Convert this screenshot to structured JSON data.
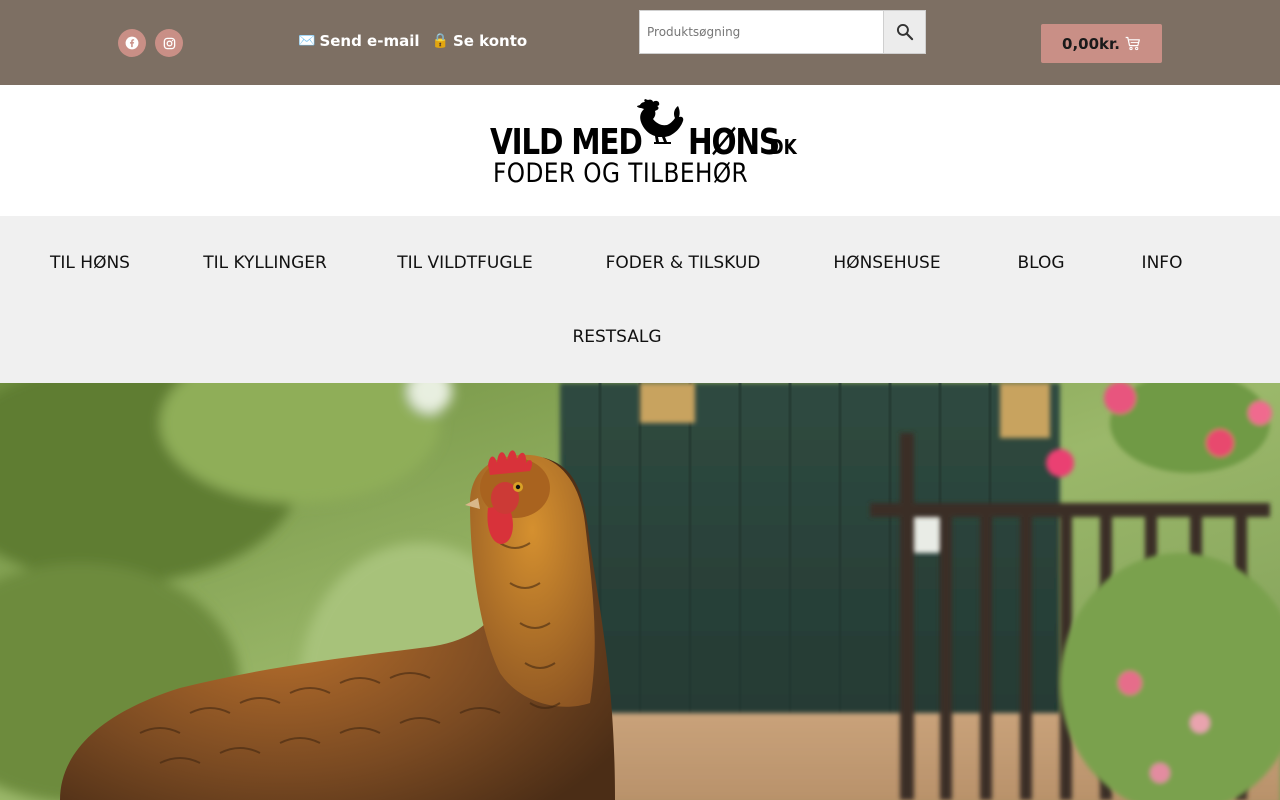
{
  "topbar": {
    "social": [
      {
        "name": "facebook",
        "icon": "facebook-icon"
      },
      {
        "name": "instagram",
        "icon": "instagram-icon"
      }
    ],
    "email_link": {
      "emoji": "✉️",
      "label": "Send e-mail"
    },
    "account_link": {
      "emoji": "🔒",
      "label": "Se konto"
    },
    "search": {
      "placeholder": "Produktsøgning",
      "value": "",
      "button_icon": "search-icon"
    },
    "cart": {
      "amount": "0,00kr.",
      "icon": "cart-icon"
    },
    "colors": {
      "bar": "#7d6f63",
      "accent": "#c98f86"
    }
  },
  "logo": {
    "word1": "VILD MED",
    "word2": "HØNS",
    "tld": ".DK",
    "tagline": "FODER OG TILBEHØR"
  },
  "nav": {
    "items": [
      {
        "label": "TIL HØNS"
      },
      {
        "label": "TIL KYLLINGER"
      },
      {
        "label": "TIL VILDTFUGLE"
      },
      {
        "label": "FODER & TILSKUD"
      },
      {
        "label": "HØNSEHUSE"
      },
      {
        "label": "BLOG"
      },
      {
        "label": "INFO"
      },
      {
        "label": "RESTSALG"
      }
    ]
  },
  "hero": {
    "image": "chicken-in-garden-photo"
  }
}
